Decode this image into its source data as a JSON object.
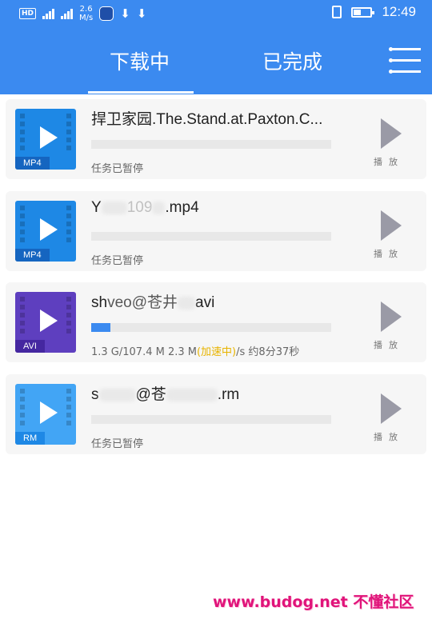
{
  "status_bar": {
    "network_badge": "HD",
    "net_speed": "2.6",
    "net_speed_unit": "M/s",
    "time": "12:49"
  },
  "tabs": {
    "downloading_label": "下载中",
    "completed_label": "已完成"
  },
  "items": [
    {
      "file_name": "捍卫家园.The.Stand.at.Paxton.C...",
      "ext": "MP4",
      "icon_color": "#1e88e5",
      "status": "任务已暂停",
      "progress": 0,
      "play_label": "播放"
    },
    {
      "file_name_prefix": "Y",
      "file_name_mid": "109",
      "file_name_suffix": ".mp4",
      "ext": "MP4",
      "icon_color": "#1e88e5",
      "status": "任务已暂停",
      "progress": 0,
      "play_label": "播放"
    },
    {
      "file_name_prefix": "sh",
      "file_name_mid": "veo@苍井",
      "file_name_suffix": "avi",
      "ext": "AVI",
      "icon_color": "#5e3fbf",
      "status_prefix": "1.3 G/107.4 M 2.3 M",
      "status_accent": "(加速中)",
      "status_suffix": "/s 约8分37秒",
      "progress": 0.08,
      "play_label": "播放"
    },
    {
      "file_name_prefix": "s",
      "file_name_mid": "@苍",
      "file_name_suffix": ".rm",
      "ext": "RM",
      "icon_color": "#42a5f5",
      "status": "任务已暂停",
      "progress": 0,
      "play_label": "播放"
    }
  ],
  "watermark": "www.budog.net 不懂社区",
  "colors": {
    "accent": "#3b8af0",
    "speed_boost": "#e8b400",
    "watermark": "#e0147a"
  }
}
